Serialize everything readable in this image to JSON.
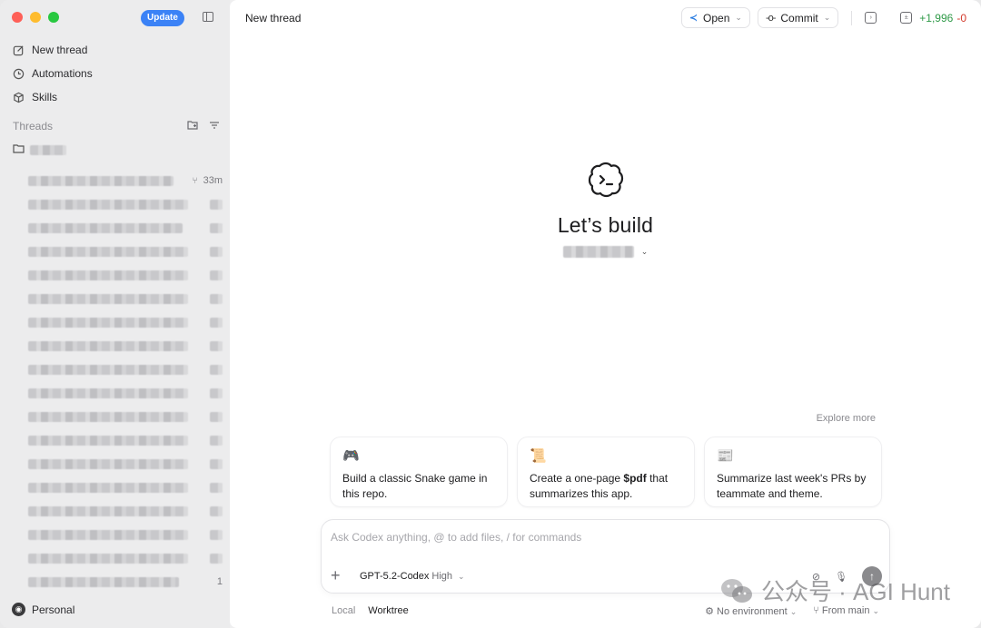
{
  "window": {
    "traffic_lights": [
      "close",
      "minimize",
      "zoom"
    ]
  },
  "sidebar": {
    "update_label": "Update",
    "nav": [
      {
        "label": "New thread",
        "icon": "edit-icon"
      },
      {
        "label": "Automations",
        "icon": "clock-icon"
      },
      {
        "label": "Skills",
        "icon": "cube-icon"
      }
    ],
    "threads_heading": "Threads",
    "threads": [
      {
        "time": "33m"
      },
      {
        "time": ""
      },
      {
        "time": ""
      },
      {
        "time": ""
      },
      {
        "time": ""
      },
      {
        "time": ""
      },
      {
        "time": ""
      },
      {
        "time": ""
      },
      {
        "time": ""
      },
      {
        "time": ""
      },
      {
        "time": ""
      },
      {
        "time": ""
      },
      {
        "time": ""
      },
      {
        "time": ""
      },
      {
        "time": ""
      },
      {
        "time": ""
      },
      {
        "time": ""
      },
      {
        "time": "1"
      }
    ],
    "account_label": "Personal"
  },
  "header": {
    "title": "New thread",
    "open_label": "Open",
    "commit_label": "Commit",
    "diff_added": "+1,996",
    "diff_removed": "-0"
  },
  "hero": {
    "title": "Let’s build"
  },
  "suggestions": {
    "explore_label": "Explore more",
    "cards": [
      {
        "icon": "🎮",
        "text": "Build a classic Snake game in this repo."
      },
      {
        "icon": "📜",
        "text_before": "Create a one-page ",
        "text_bold": "$pdf",
        "text_after": " that summarizes this app."
      },
      {
        "icon": "📰",
        "text": "Summarize last week's PRs by teammate and theme."
      }
    ]
  },
  "composer": {
    "placeholder": "Ask Codex anything, @ to add files, / for commands",
    "value": "",
    "model": "GPT-5.2-Codex",
    "effort": "High"
  },
  "footer": {
    "local_label": "Local",
    "worktree_label": "Worktree",
    "environment_label": "No environment",
    "branch_label": "From main"
  },
  "watermark": {
    "text": "公众号 · AGI Hunt"
  },
  "colors": {
    "accent": "#3b82f6",
    "diff_added": "#2f9a48",
    "diff_removed": "#d33a2c"
  }
}
